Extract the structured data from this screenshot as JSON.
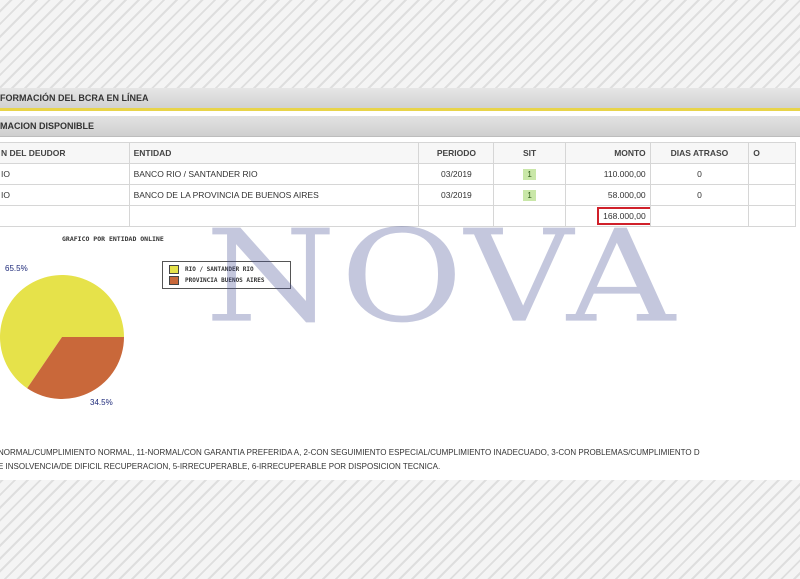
{
  "header": {
    "title": "FORMACIÓN DEL BCRA EN LÍNEA"
  },
  "section": {
    "title": "MACION DISPONIBLE"
  },
  "table": {
    "columns": [
      "N DEL DEUDOR",
      "ENTIDAD",
      "PERIODO",
      "SIT",
      "MONTO",
      "DIAS ATRASO",
      "O"
    ],
    "rows": [
      {
        "deudor": "IO",
        "entidad": "BANCO RIO / SANTANDER RIO",
        "periodo": "03/2019",
        "sit": "1",
        "monto": "110.000,00",
        "dias": "0"
      },
      {
        "deudor": "IO",
        "entidad": "BANCO DE LA PROVINCIA DE BUENOS AIRES",
        "periodo": "03/2019",
        "sit": "1",
        "monto": "58.000,00",
        "dias": "0"
      }
    ],
    "total": "168.000,00"
  },
  "chart_data": {
    "type": "pie",
    "title": "GRAFICO POR ENTIDAD ONLINE",
    "series": [
      {
        "name": "RIO / SANTANDER RIO",
        "value": 65.5,
        "label": "65.5%",
        "color": "#e6e24a"
      },
      {
        "name": "PROVINCIA BUENOS AIRES",
        "value": 34.5,
        "label": "34.5%",
        "color": "#c9683a"
      }
    ],
    "legend": "right"
  },
  "footnote": {
    "line1": "NORMAL/CUMPLIMIENTO NORMAL, 11-NORMAL/CON GARANTIA PREFERIDA A, 2-CON SEGUIMIENTO ESPECIAL/CUMPLIMIENTO INADECUADO, 3-CON PROBLEMAS/CUMPLIMIENTO D",
    "line2": "E INSOLVENCIA/DE DIFICIL RECUPERACION, 5-IRRECUPERABLE, 6-IRRECUPERABLE POR DISPOSICION TECNICA."
  },
  "watermark": "NOVA"
}
